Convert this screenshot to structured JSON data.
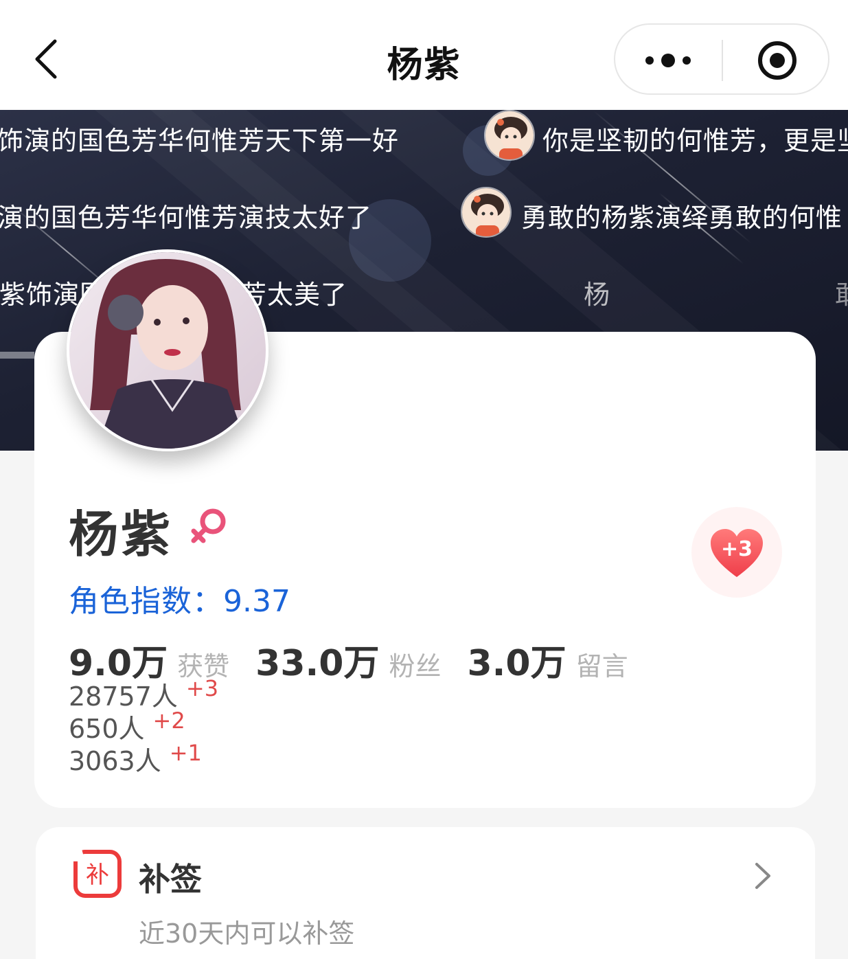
{
  "nav": {
    "title": "杨紫"
  },
  "banner": {
    "barrage": [
      {
        "text": "饰演的国色芳华何惟芳天下第一好",
        "has_avatar": false
      },
      {
        "text": "你是坚韧的何惟芳，更是坚",
        "has_avatar": true
      },
      {
        "text": "演的国色芳华何惟芳演技太好了",
        "has_avatar": false
      },
      {
        "text": "勇敢的杨紫演绎勇敢的何惟",
        "has_avatar": true
      },
      {
        "text": "杨紫饰演国色芳华何惟芳太美了",
        "has_avatar": false
      }
    ],
    "faint_chars": [
      "杨",
      "敢"
    ]
  },
  "profile": {
    "name": "杨紫",
    "gender": "female",
    "index_label": "角色指数：",
    "index_value": "9.37",
    "like_badge": "+3",
    "stats": [
      {
        "value": "9.0万",
        "label": "获赞"
      },
      {
        "value": "33.0万",
        "label": "粉丝"
      },
      {
        "value": "3.0万",
        "label": "留言"
      }
    ],
    "counts": [
      {
        "value": "28757人",
        "delta": "+3"
      },
      {
        "value": "650人",
        "delta": "+2"
      },
      {
        "value": "3063人",
        "delta": "+1"
      }
    ]
  },
  "makeup": {
    "icon_char": "补",
    "title": "补签",
    "subtitle": "近30天内可以补签"
  },
  "colors": {
    "accent_blue": "#1a63d8",
    "accent_red": "#e04a4a",
    "gender_pink": "#e9537a"
  }
}
